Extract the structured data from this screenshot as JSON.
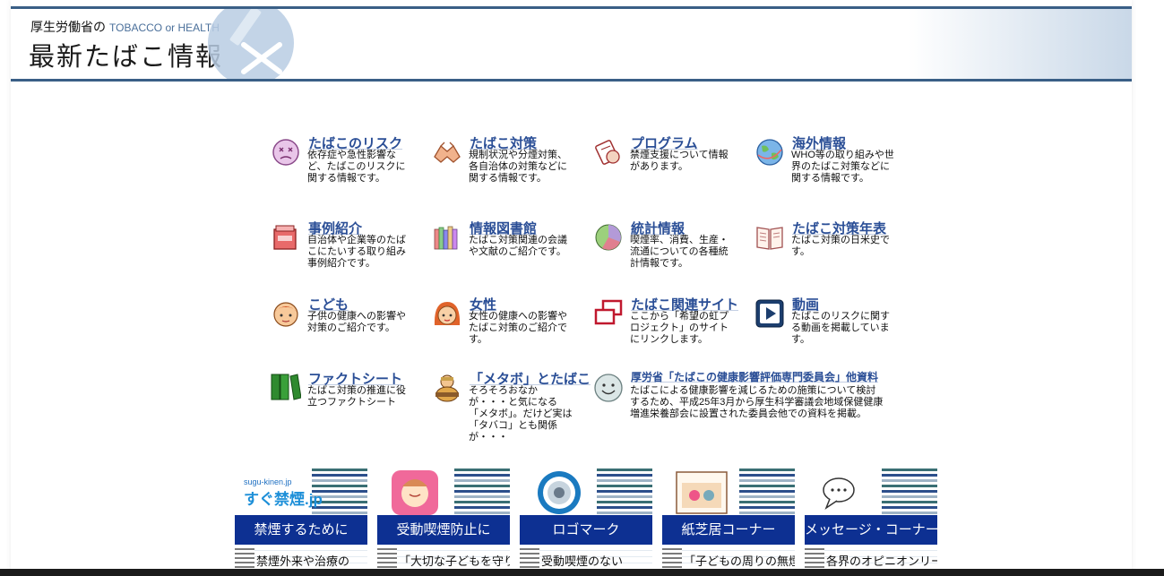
{
  "header": {
    "ministry": "厚生労働省の",
    "subtitle_en": "TOBACCO or HEALTH",
    "title": "最新たばこ情報"
  },
  "tiles": [
    {
      "icon": "sick-face-icon",
      "title": "たばこのリスク",
      "desc": "依存症や急性影響など、たばこのリスクに関する情報です。"
    },
    {
      "icon": "handshake-icon",
      "title": "たばこ対策",
      "desc": "規制状況や分煙対策、各自治体の対策などに関する情報です。"
    },
    {
      "icon": "program-icon",
      "title": "プログラム",
      "desc": "禁煙支援について情報があります。"
    },
    {
      "icon": "globe-icon",
      "title": "海外情報",
      "desc": "WHO等の取り組みや世界のたばこ対策などに関する情報です。"
    },
    {
      "icon": "case-box-icon",
      "title": "事例紹介",
      "desc": "自治体や企業等のたばこにたいする取り組み事例紹介です。"
    },
    {
      "icon": "books-icon",
      "title": "情報図書館",
      "desc": "たばこ対策関連の会議や文献のご紹介です。"
    },
    {
      "icon": "pie-chart-icon",
      "title": "統計情報",
      "desc": "喫煙率、消費、生産・流通についての各種統計情報です。"
    },
    {
      "icon": "open-book-icon",
      "title": "たばこ対策年表",
      "desc": "たばこ対策の日米史です。"
    },
    {
      "icon": "boy-face-icon",
      "title": "こども",
      "desc": "子供の健康への影響や対策のご紹介です。"
    },
    {
      "icon": "woman-face-icon",
      "title": "女性",
      "desc": "女性の健康への影響やたばこ対策のご紹介です。"
    },
    {
      "icon": "linked-windows-icon",
      "title": "たばこ関連サイト",
      "desc": "ここから「希望の虹プロジェクト」のサイトにリンクします。"
    },
    {
      "icon": "video-play-icon",
      "title": "動画",
      "desc": "たばこのリスクに関する動画を掲載しています。"
    },
    {
      "icon": "green-binders-icon",
      "title": "ファクトシート",
      "desc": "たばこ対策の推進に役立つファクトシート"
    },
    {
      "icon": "metabo-man-icon",
      "title": "「メタボ」とたばこ",
      "desc": "そろそろおなかが・・・と気になる「メタボ」。だけど実は「タバコ」とも関係が・・・"
    },
    {
      "icon": "smile-face-icon",
      "title": "厚労省「たばこの健康影響評価専門委員会」他資料",
      "desc": "たばこによる健康影響を減じるための施策について検討するため、平成25年3月から厚生科学審議会地域保健健康増進栄養部会に設置された委員会他での資料を掲載。"
    }
  ],
  "banners": [
    {
      "icon": "sugu-kinen-logo-icon",
      "logo_small": "sugu-kinen.jp",
      "logo_big": "すぐ禁煙.jp",
      "label": "禁煙するために",
      "sub": "禁煙外来や治療の"
    },
    {
      "icon": "pink-baby-badge-icon",
      "label": "受動喫煙防止に",
      "sub": "「大切な子どもを守り"
    },
    {
      "icon": "no-smoking-mark-icon",
      "label": "ロゴマーク",
      "sub": "受動喫煙のない"
    },
    {
      "icon": "kamishibai-icon",
      "label": "紙芝居コーナー",
      "sub": "「子どもの周りの無煙"
    },
    {
      "icon": "speech-bubble-icon",
      "label": "メッセージ・コーナー",
      "sub": "各界のオピニオンリーダー"
    }
  ]
}
